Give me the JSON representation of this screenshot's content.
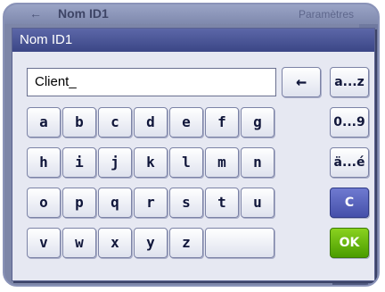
{
  "background": {
    "title": "Nom ID1",
    "right_label": "Paramètres"
  },
  "dialog": {
    "title": "Nom ID1",
    "input_value": "Client_"
  },
  "keys": {
    "row1": [
      "a",
      "b",
      "c",
      "d",
      "e",
      "f",
      "g"
    ],
    "row2": [
      "h",
      "i",
      "j",
      "k",
      "l",
      "m",
      "n"
    ],
    "row3": [
      "o",
      "p",
      "q",
      "r",
      "s",
      "t",
      "u"
    ],
    "row4": [
      "v",
      "w",
      "x",
      "y",
      "z"
    ]
  },
  "side_keys": {
    "lower": "a...z",
    "digits": "0...9",
    "accents": "ä...é",
    "clear": "C",
    "ok": "OK"
  },
  "icons": {
    "backspace": "backspace-arrow-icon"
  },
  "colors": {
    "title_bar": "#3b4686",
    "clear_key": "#4550aa",
    "ok_key": "#4a9c00"
  }
}
